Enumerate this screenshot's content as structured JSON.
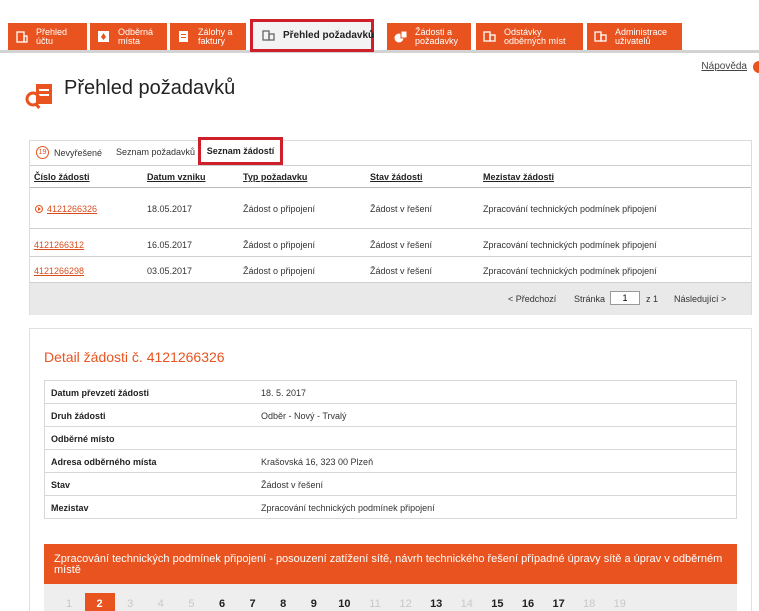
{
  "nav": {
    "tabs": [
      {
        "label": "Přehled účtu",
        "icon": "building-icon"
      },
      {
        "label": "Odběrná místa",
        "icon": "location-icon"
      },
      {
        "label": "Zálohy a faktury",
        "icon": "invoice-icon"
      },
      {
        "label": "Přehled požadavků",
        "icon": "requests-icon",
        "active": true
      },
      {
        "label": "Žádosti a požadavky",
        "icon": "request-form-icon"
      },
      {
        "label": "Odstávky odběrných míst",
        "icon": "outage-icon"
      },
      {
        "label": "Administrace uživatelů",
        "icon": "users-icon"
      }
    ],
    "accent": "#e8531f",
    "highlight": "#cf1f2b"
  },
  "header": {
    "help_label": "Nápověda",
    "title": "Přehled požadavků"
  },
  "requests": {
    "tabs": {
      "unresolved_count": "19",
      "unresolved_label": "Nevyřešené",
      "list_label": "Seznam požadavků",
      "active_label": "Seznam žádostí"
    },
    "columns": [
      "Číslo žádosti",
      "Datum vzniku",
      "Typ požadavku",
      "Stav žádosti",
      "Mezistav žádosti"
    ],
    "rows": [
      {
        "number": "4121266326",
        "date": "18.05.2017",
        "type": "Žádost o připojení",
        "status": "Žádost v řešení",
        "substatus": "Zpracování technických podmínek připojení"
      },
      {
        "number": "4121266312",
        "date": "16.05.2017",
        "type": "Žádost o připojení",
        "status": "Žádost v řešení",
        "substatus": "Zpracování technických podmínek připojení"
      },
      {
        "number": "4121266298",
        "date": "03.05.2017",
        "type": "Žádost o připojení",
        "status": "Žádost v řešení",
        "substatus": "Zpracování technických podmínek připojení"
      }
    ],
    "pager": {
      "prev": "< Předchozí",
      "page_label": "Stránka",
      "page_value": "1",
      "total": "z 1",
      "next": "Následující >"
    }
  },
  "detail": {
    "title": "Detail žádosti č. 4121266326",
    "rows": [
      {
        "key": "Datum převzetí žádosti",
        "value": "18. 5. 2017"
      },
      {
        "key": "Druh žádosti",
        "value": "Odběr - Nový - Trvalý"
      },
      {
        "key": "Odběrné místo",
        "value": ""
      },
      {
        "key": "Adresa odběrného místa",
        "value": "Krašovská 16, 323 00 Plzeň"
      },
      {
        "key": "Stav",
        "value": "Žádost v řešení"
      },
      {
        "key": "Mezistav",
        "value": "Zpracování technických podmínek připojení"
      }
    ],
    "banner": "Zpracování technických podmínek připojení - posouzení zatížení sítě, návrh technického řešení případné úpravy sítě a úprav v odběrném místě",
    "steps": [
      {
        "n": "1",
        "state": "future"
      },
      {
        "n": "2",
        "state": "current"
      },
      {
        "n": "3",
        "state": "future"
      },
      {
        "n": "4",
        "state": "future"
      },
      {
        "n": "5",
        "state": "future"
      },
      {
        "n": "6",
        "state": "done"
      },
      {
        "n": "7",
        "state": "done"
      },
      {
        "n": "8",
        "state": "done"
      },
      {
        "n": "9",
        "state": "done"
      },
      {
        "n": "10",
        "state": "done"
      },
      {
        "n": "11",
        "state": "future"
      },
      {
        "n": "12",
        "state": "future"
      },
      {
        "n": "13",
        "state": "done"
      },
      {
        "n": "14",
        "state": "future"
      },
      {
        "n": "15",
        "state": "done"
      },
      {
        "n": "16",
        "state": "done"
      },
      {
        "n": "17",
        "state": "done"
      },
      {
        "n": "18",
        "state": "future"
      },
      {
        "n": "19",
        "state": "future"
      }
    ]
  }
}
